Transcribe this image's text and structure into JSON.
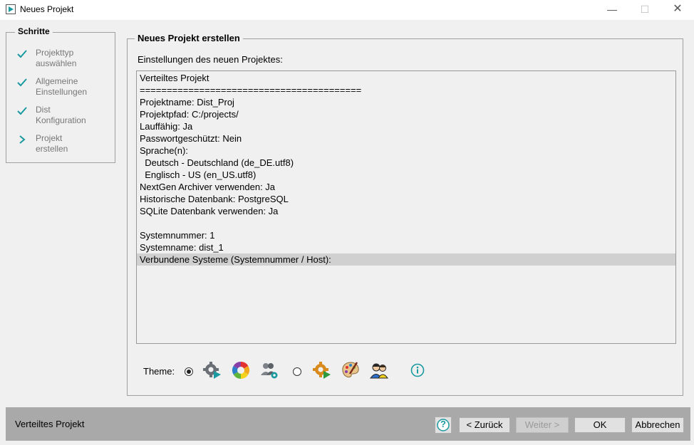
{
  "window": {
    "title": "Neues Projekt",
    "controls": {
      "minimize": "—",
      "maximize": "☐",
      "close": "✕"
    }
  },
  "steps": {
    "title": "Schritte",
    "items": [
      {
        "label_line1": "Projekttyp",
        "label_line2": "auswählen",
        "state": "done",
        "marker": "✓"
      },
      {
        "label_line1": "Allgemeine",
        "label_line2": "Einstellungen",
        "state": "done",
        "marker": "✓"
      },
      {
        "label_line1": "Dist",
        "label_line2": "Konfiguration",
        "state": "done",
        "marker": "✓"
      },
      {
        "label_line1": "Projekt",
        "label_line2": "erstellen",
        "state": "current",
        "marker": "›"
      }
    ]
  },
  "main": {
    "title": "Neues Projekt erstellen",
    "subheading": "Einstellungen des neuen Projektes:",
    "summary_lines": [
      "Verteiltes Projekt",
      "=========================================",
      "Projektname: Dist_Proj",
      "Projektpfad: C:/projects/",
      "Lauffähig: Ja",
      "Passwortgeschützt: Nein",
      "Sprache(n):",
      "  Deutsch - Deutschland (de_DE.utf8)",
      "  Englisch - US (en_US.utf8)",
      "NextGen Archiver verwenden: Ja",
      "Historische Datenbank: PostgreSQL",
      "SQLite Datenbank verwenden: Ja",
      "",
      "Systemnummer: 1",
      "Systemname: dist_1",
      "Verbundene Systeme (Systemnummer / Host):"
    ],
    "selected_line_index": 15
  },
  "theme": {
    "label": "Theme:",
    "options": [
      {
        "selected": true,
        "icons": [
          "gear-play-icon",
          "color-wheel-icon",
          "users-gear-icon"
        ]
      },
      {
        "selected": false,
        "icons": [
          "gear-arrow-icon",
          "palette-icon",
          "people-icon"
        ]
      }
    ],
    "info_icon": "info-icon"
  },
  "statusbar": {
    "text": "Verteiltes Projekt",
    "help_label": "?",
    "back_label": "< Zurück",
    "next_label": "Weiter >",
    "ok_label": "OK",
    "cancel_label": "Abbrechen"
  },
  "colors": {
    "accent": "#1a9aa0",
    "statusbar": "#a9a9a9",
    "selection": "#d0d0d0"
  }
}
